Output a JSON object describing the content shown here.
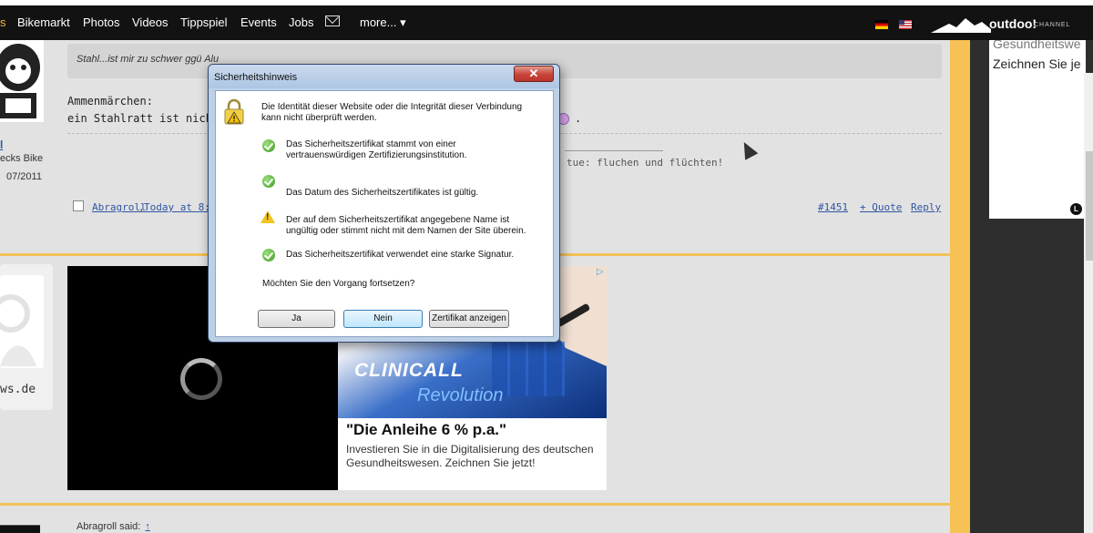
{
  "nav": {
    "partial_item": "s",
    "items": [
      "Bikemarkt",
      "Photos",
      "Videos",
      "Tippspiel",
      "Events",
      "Jobs"
    ],
    "more": "more... ▾",
    "logo_text": "outdoo!",
    "logo_sub": "CHANNEL"
  },
  "right_ad": {
    "line_top": "Gesundheitswe",
    "line": "Zeichnen Sie je",
    "badge": "L"
  },
  "post1": {
    "quote": "Stahl...ist mir zu schwer ggü Alu",
    "line1": "Ammenmärchen:",
    "line2": "ein Stahlratt ist nicht sc",
    "line2_end": ".",
    "signature": "tue: fluchen und flüchten!",
    "user_initial": "l",
    "user_line1": "ecks Bike",
    "user_line2": "07/2011",
    "author": "Abragroll",
    "time": "Today at 8:4",
    "post_no": "#1451",
    "quote_btn": "+ Quote",
    "reply_btn": "Reply"
  },
  "post2": {
    "user_site": "ws.de"
  },
  "ad": {
    "brand": "CLINICALL",
    "tagline": "Revolution",
    "headline": "\"Die Anleihe 6 % p.a.\"",
    "body": "Investieren Sie in die Digitalisierung des deutschen Gesundheitswesen. Zeichnen Sie jetzt!"
  },
  "post3": {
    "said": "Abragroll said:",
    "arrow": "↑"
  },
  "dialog": {
    "title": "Sicherheitshinweis",
    "close": "✕",
    "intro_1": "Die Identität dieser Website oder die Integrität dieser Verbindung",
    "intro_2": "kann nicht überprüft werden.",
    "item1_1": "Das Sicherheitszertifikat stammt von einer",
    "item1_2": "vertrauenswürdigen Zertifizierungsinstitution.",
    "item2": "Das Datum des Sicherheitszertifikates ist gültig.",
    "item3_1": "Der auf dem Sicherheitszertifikat angegebene Name ist",
    "item3_2": "ungültig oder stimmt nicht mit dem Namen der Site überein.",
    "item4": "Das Sicherheitszertifikat verwendet eine starke Signatur.",
    "question": "Möchten Sie den Vorgang fortsetzen?",
    "btn_yes": "Ja",
    "btn_no": "Nein",
    "btn_cert": "Zertifikat anzeigen"
  }
}
